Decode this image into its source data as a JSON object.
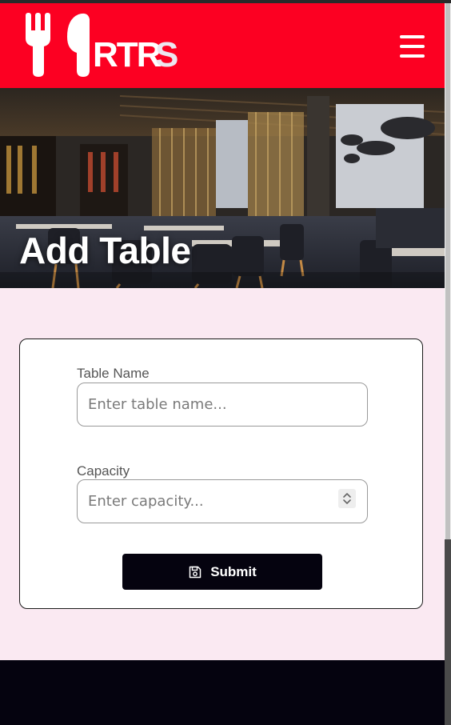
{
  "header": {
    "brand": "RTRS",
    "menu_icon": "hamburger-menu-icon",
    "color": "#fc0022"
  },
  "hero": {
    "title": "Add Table",
    "image": "restaurant-interior-photo"
  },
  "form": {
    "table_name": {
      "label": "Table Name",
      "placeholder": "Enter table name...",
      "value": ""
    },
    "capacity": {
      "label": "Capacity",
      "placeholder": "Enter capacity...",
      "value": ""
    },
    "submit": {
      "label": "Submit",
      "icon": "floppy-disk-save-icon"
    }
  },
  "colors": {
    "page_background": "#fae9f2",
    "footer": "#05030f",
    "button": "#05030f"
  }
}
